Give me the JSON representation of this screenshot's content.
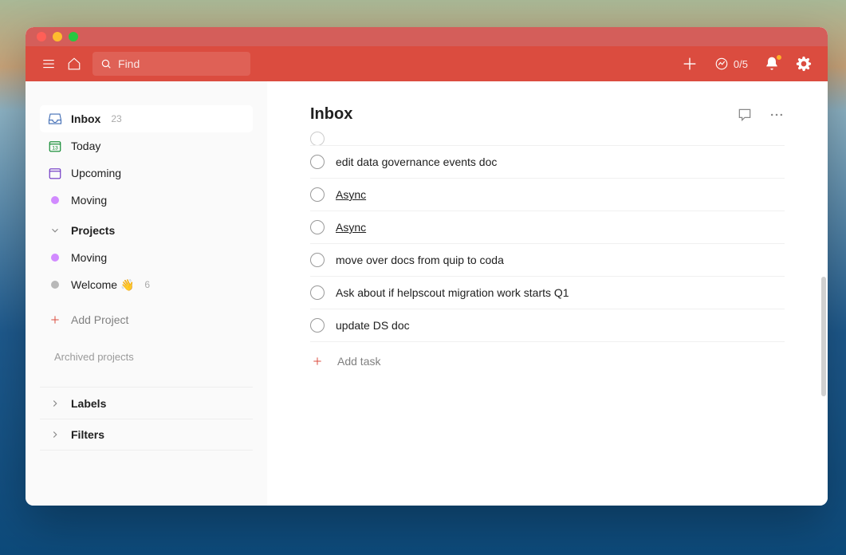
{
  "search": {
    "placeholder": "Find"
  },
  "toolbar": {
    "productivity": "0/5"
  },
  "sidebar": {
    "inbox": {
      "label": "Inbox",
      "count": "23"
    },
    "today": {
      "label": "Today"
    },
    "upcoming": {
      "label": "Upcoming"
    },
    "favorites": [
      {
        "label": "Moving",
        "color": "#d18aff"
      }
    ],
    "projects_header": "Projects",
    "projects": [
      {
        "label": "Moving",
        "color": "#d18aff",
        "count": ""
      },
      {
        "label": "Welcome 👋",
        "color": "#b8b8b8",
        "count": "6"
      }
    ],
    "add_project": "Add Project",
    "archived_label": "Archived projects",
    "labels_header": "Labels",
    "filters_header": "Filters"
  },
  "main": {
    "title": "Inbox",
    "tasks": [
      {
        "label": "edit data governance events doc",
        "link": false
      },
      {
        "label": "Async",
        "link": true
      },
      {
        "label": "Async",
        "link": true
      },
      {
        "label": "move over docs from quip to coda",
        "link": false
      },
      {
        "label": "Ask about if helpscout migration work starts Q1",
        "link": false
      },
      {
        "label": "update DS doc",
        "link": false
      }
    ],
    "add_task": "Add task"
  }
}
